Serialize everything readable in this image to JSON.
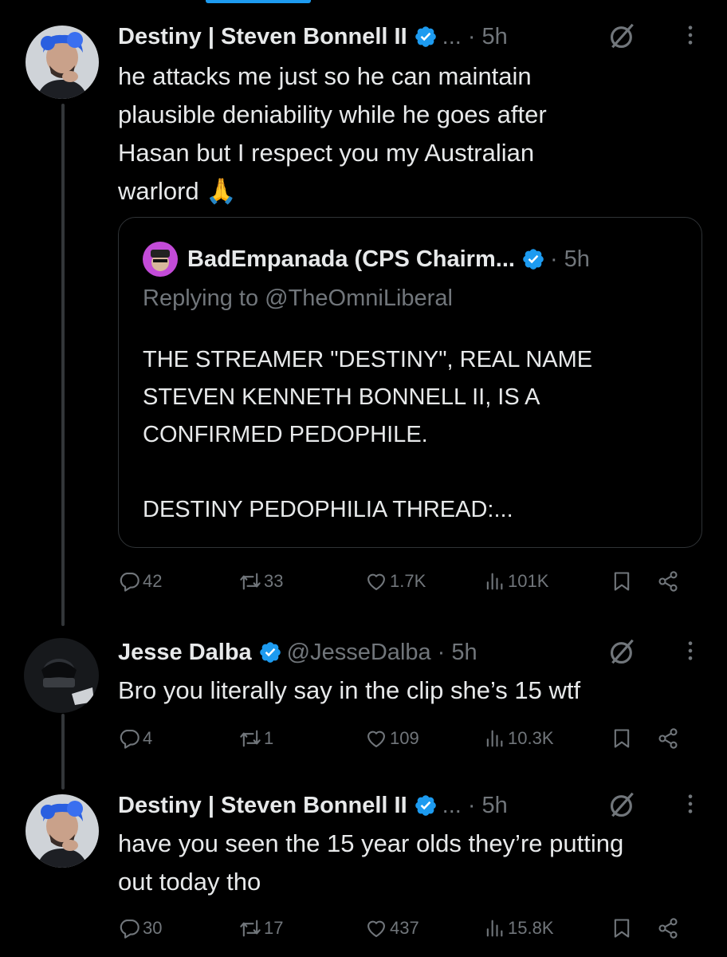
{
  "colors": {
    "background": "#000000",
    "text": "#e7e9ea",
    "muted": "#71767b",
    "verified": "#1d9bf0",
    "border": "#2f3336"
  },
  "tweets": [
    {
      "name": "Destiny | Steven Bonnell II",
      "handle_truncation": "...",
      "time": "· 5h",
      "text_lines": [
        "he attacks me just so he can maintain",
        "plausible deniability while he goes after",
        "Hasan but I respect you my Australian",
        "warlord 🙏"
      ],
      "quote": {
        "name": "BadEmpanada (CPS Chairm...",
        "time": "· 5h",
        "replying": "Replying to @TheOmniLiberal",
        "lines": [
          "THE STREAMER \"DESTINY\", REAL NAME",
          "STEVEN KENNETH BONNELL II, IS A",
          "CONFIRMED PEDOPHILE.",
          "",
          "DESTINY PEDOPHILIA THREAD:..."
        ]
      },
      "stats": {
        "replies": "42",
        "reposts": "33",
        "likes": "1.7K",
        "views": "101K"
      }
    },
    {
      "name": "Jesse Dalba",
      "handle": "@JesseDalba",
      "time": "· 5h",
      "text_lines": [
        "Bro you literally say in the clip she’s 15 wtf"
      ],
      "stats": {
        "replies": "4",
        "reposts": "1",
        "likes": "109",
        "views": "10.3K"
      }
    },
    {
      "name": "Destiny | Steven Bonnell II",
      "handle_truncation": "...",
      "time": "· 5h",
      "text_lines": [
        "have you seen the 15 year olds they’re putting",
        "out today tho"
      ],
      "stats": {
        "replies": "30",
        "reposts": "17",
        "likes": "437",
        "views": "15.8K"
      }
    }
  ],
  "icons": [
    "grok-icon",
    "more-icon",
    "verified-badge-icon",
    "reply-icon",
    "repost-icon",
    "like-icon",
    "views-icon",
    "bookmark-icon",
    "share-icon"
  ]
}
